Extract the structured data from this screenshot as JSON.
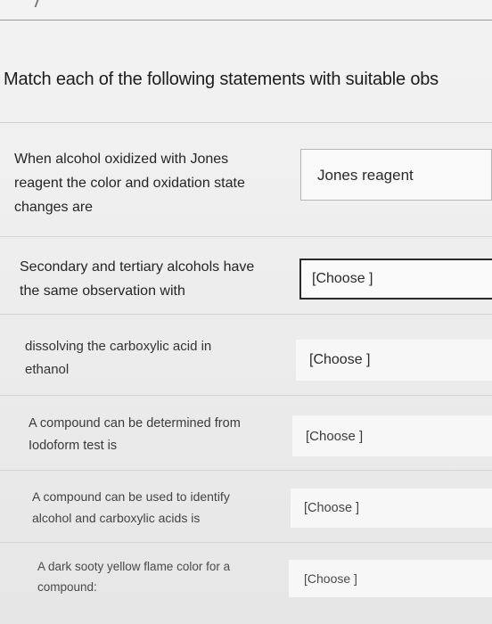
{
  "question": {
    "prompt": "Match each of the following statements with suitable obs"
  },
  "rows": [
    {
      "statement": [
        "When alcohol oxidized with Jones",
        "reagent the color and oxidation state",
        "changes are"
      ],
      "answer": "Jones reagent"
    },
    {
      "statement": [
        "Secondary and tertiary alcohols have",
        "the same observation with"
      ],
      "answer": "[Choose ]"
    },
    {
      "statement": [
        "dissolving the carboxylic acid in",
        "ethanol"
      ],
      "answer": "[Choose ]"
    },
    {
      "statement": [
        "A compound can be determined from",
        "Iodoform test is"
      ],
      "answer": "[Choose ]"
    },
    {
      "statement": [
        "A compound can be used to identify",
        "alcohol and carboxylic acids is"
      ],
      "answer": "[Choose ]"
    },
    {
      "statement": [
        "A dark sooty yellow flame color for a",
        "compound:"
      ],
      "answer": "[Choose ]"
    }
  ]
}
